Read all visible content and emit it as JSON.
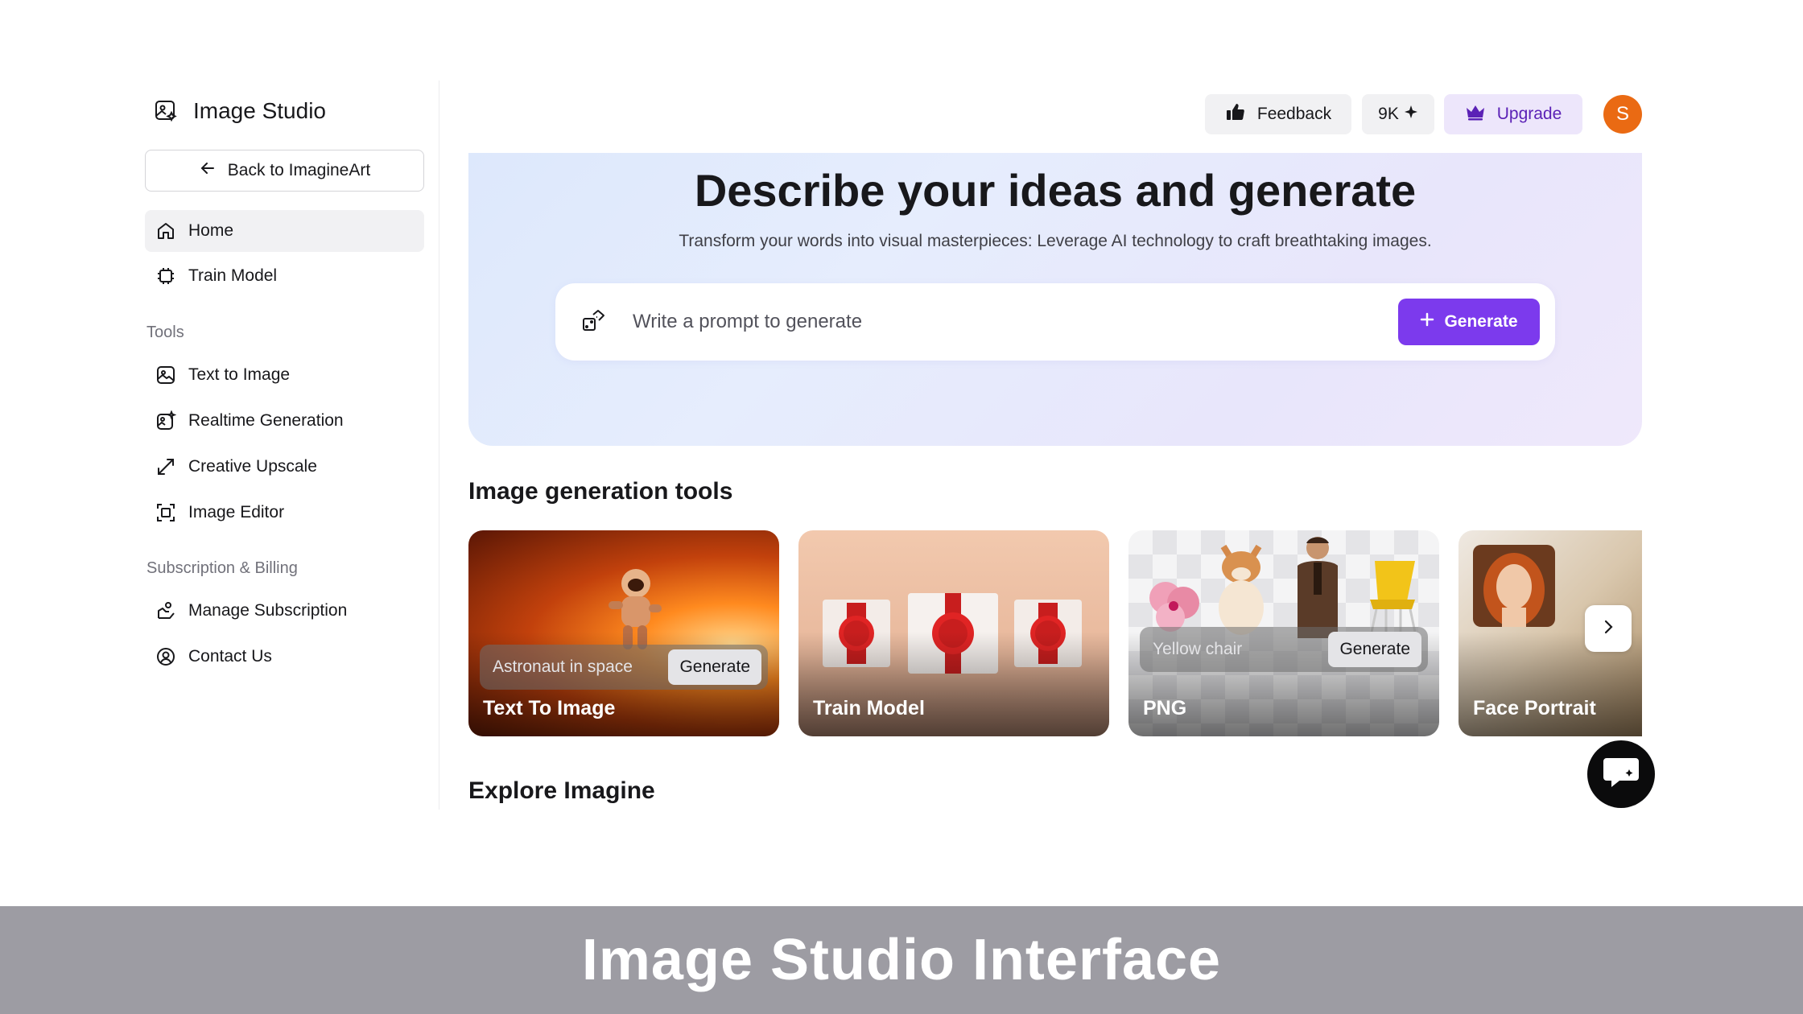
{
  "sidebar": {
    "brand": "Image Studio",
    "back_label": "Back to ImagineArt",
    "main_items": [
      {
        "label": "Home",
        "icon": "home-icon"
      },
      {
        "label": "Train Model",
        "icon": "chip-icon"
      }
    ],
    "tools_label": "Tools",
    "tools": [
      {
        "label": "Text to Image",
        "icon": "image-icon"
      },
      {
        "label": "Realtime Generation",
        "icon": "sparkle-image-icon"
      },
      {
        "label": "Creative Upscale",
        "icon": "expand-arrows-icon"
      },
      {
        "label": "Image Editor",
        "icon": "crop-frame-icon"
      }
    ],
    "billing_label": "Subscription & Billing",
    "billing": [
      {
        "label": "Manage Subscription",
        "icon": "hand-coins-icon"
      },
      {
        "label": "Contact Us",
        "icon": "contact-icon"
      }
    ]
  },
  "topbar": {
    "feedback": "Feedback",
    "credits": "9K",
    "upgrade": "Upgrade",
    "avatar_initial": "S"
  },
  "hero": {
    "title": "Describe your ideas and generate",
    "subtitle": "Transform your words into visual masterpieces: Leverage AI technology to craft breathtaking images.",
    "prompt_placeholder": "Write a prompt to generate",
    "generate": "Generate"
  },
  "tools_section": {
    "heading": "Image generation tools",
    "cards": [
      {
        "title": "Text To Image",
        "prompt": "Astronaut in space",
        "action": "Generate"
      },
      {
        "title": "Train Model"
      },
      {
        "title": "PNG",
        "prompt": "Yellow chair",
        "action": "Generate"
      },
      {
        "title": "Face Portrait"
      }
    ]
  },
  "explore_heading": "Explore Imagine",
  "caption": "Image Studio Interface",
  "colors": {
    "accent": "#7c3aed",
    "avatar": "#ea6a13",
    "caption_band": "#9d9ca3"
  }
}
